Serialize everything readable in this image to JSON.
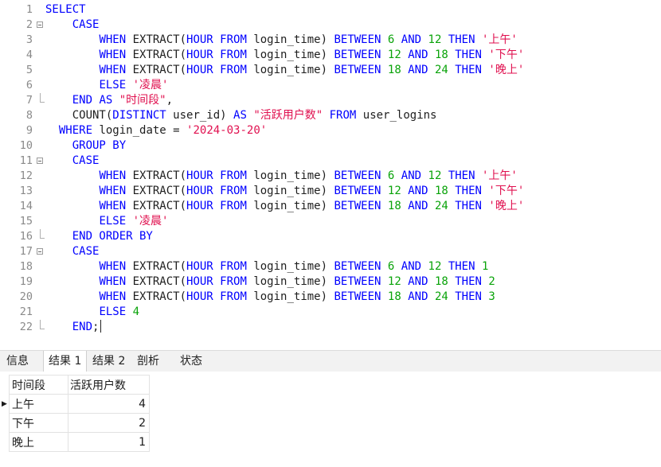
{
  "editor": {
    "lines": [
      {
        "n": "1",
        "fold": "",
        "tokens": [
          {
            "t": "SELECT",
            "c": "kw"
          }
        ]
      },
      {
        "n": "2",
        "fold": "open",
        "tokens": [
          {
            "t": "    "
          },
          {
            "t": "CASE",
            "c": "kw"
          }
        ]
      },
      {
        "n": "3",
        "fold": "",
        "tokens": [
          {
            "t": "        "
          },
          {
            "t": "WHEN",
            "c": "kw"
          },
          {
            "t": " EXTRACT("
          },
          {
            "t": "HOUR",
            "c": "kw"
          },
          {
            "t": " "
          },
          {
            "t": "FROM",
            "c": "kw"
          },
          {
            "t": " login_time) "
          },
          {
            "t": "BETWEEN",
            "c": "kw"
          },
          {
            "t": " "
          },
          {
            "t": "6",
            "c": "num"
          },
          {
            "t": " "
          },
          {
            "t": "AND",
            "c": "kw"
          },
          {
            "t": " "
          },
          {
            "t": "12",
            "c": "num"
          },
          {
            "t": " "
          },
          {
            "t": "THEN",
            "c": "kw"
          },
          {
            "t": " "
          },
          {
            "t": "'上午'",
            "c": "str"
          }
        ]
      },
      {
        "n": "4",
        "fold": "",
        "tokens": [
          {
            "t": "        "
          },
          {
            "t": "WHEN",
            "c": "kw"
          },
          {
            "t": " EXTRACT("
          },
          {
            "t": "HOUR",
            "c": "kw"
          },
          {
            "t": " "
          },
          {
            "t": "FROM",
            "c": "kw"
          },
          {
            "t": " login_time) "
          },
          {
            "t": "BETWEEN",
            "c": "kw"
          },
          {
            "t": " "
          },
          {
            "t": "12",
            "c": "num"
          },
          {
            "t": " "
          },
          {
            "t": "AND",
            "c": "kw"
          },
          {
            "t": " "
          },
          {
            "t": "18",
            "c": "num"
          },
          {
            "t": " "
          },
          {
            "t": "THEN",
            "c": "kw"
          },
          {
            "t": " "
          },
          {
            "t": "'下午'",
            "c": "str"
          }
        ]
      },
      {
        "n": "5",
        "fold": "",
        "tokens": [
          {
            "t": "        "
          },
          {
            "t": "WHEN",
            "c": "kw"
          },
          {
            "t": " EXTRACT("
          },
          {
            "t": "HOUR",
            "c": "kw"
          },
          {
            "t": " "
          },
          {
            "t": "FROM",
            "c": "kw"
          },
          {
            "t": " login_time) "
          },
          {
            "t": "BETWEEN",
            "c": "kw"
          },
          {
            "t": " "
          },
          {
            "t": "18",
            "c": "num"
          },
          {
            "t": " "
          },
          {
            "t": "AND",
            "c": "kw"
          },
          {
            "t": " "
          },
          {
            "t": "24",
            "c": "num"
          },
          {
            "t": " "
          },
          {
            "t": "THEN",
            "c": "kw"
          },
          {
            "t": " "
          },
          {
            "t": "'晚上'",
            "c": "str"
          }
        ]
      },
      {
        "n": "6",
        "fold": "",
        "tokens": [
          {
            "t": "        "
          },
          {
            "t": "ELSE",
            "c": "kw"
          },
          {
            "t": " "
          },
          {
            "t": "'凌晨'",
            "c": "str"
          }
        ]
      },
      {
        "n": "7",
        "fold": "end",
        "tokens": [
          {
            "t": "    "
          },
          {
            "t": "END",
            "c": "kw"
          },
          {
            "t": " "
          },
          {
            "t": "AS",
            "c": "kw"
          },
          {
            "t": " "
          },
          {
            "t": "\"时间段\"",
            "c": "str"
          },
          {
            "t": ","
          }
        ]
      },
      {
        "n": "8",
        "fold": "",
        "tokens": [
          {
            "t": "    COUNT("
          },
          {
            "t": "DISTINCT",
            "c": "kw"
          },
          {
            "t": " user_id) "
          },
          {
            "t": "AS",
            "c": "kw"
          },
          {
            "t": " "
          },
          {
            "t": "\"活跃用户数\"",
            "c": "str"
          },
          {
            "t": " "
          },
          {
            "t": "FROM",
            "c": "kw"
          },
          {
            "t": " user_logins"
          }
        ]
      },
      {
        "n": "9",
        "fold": "",
        "tokens": [
          {
            "t": "  "
          },
          {
            "t": "WHERE",
            "c": "kw"
          },
          {
            "t": " login_date = "
          },
          {
            "t": "'2024-03-20'",
            "c": "str"
          }
        ]
      },
      {
        "n": "10",
        "fold": "",
        "tokens": [
          {
            "t": "    "
          },
          {
            "t": "GROUP BY",
            "c": "kw"
          }
        ]
      },
      {
        "n": "11",
        "fold": "open",
        "tokens": [
          {
            "t": "    "
          },
          {
            "t": "CASE",
            "c": "kw"
          }
        ]
      },
      {
        "n": "12",
        "fold": "",
        "tokens": [
          {
            "t": "        "
          },
          {
            "t": "WHEN",
            "c": "kw"
          },
          {
            "t": " EXTRACT("
          },
          {
            "t": "HOUR",
            "c": "kw"
          },
          {
            "t": " "
          },
          {
            "t": "FROM",
            "c": "kw"
          },
          {
            "t": " login_time) "
          },
          {
            "t": "BETWEEN",
            "c": "kw"
          },
          {
            "t": " "
          },
          {
            "t": "6",
            "c": "num"
          },
          {
            "t": " "
          },
          {
            "t": "AND",
            "c": "kw"
          },
          {
            "t": " "
          },
          {
            "t": "12",
            "c": "num"
          },
          {
            "t": " "
          },
          {
            "t": "THEN",
            "c": "kw"
          },
          {
            "t": " "
          },
          {
            "t": "'上午'",
            "c": "str"
          }
        ]
      },
      {
        "n": "13",
        "fold": "",
        "tokens": [
          {
            "t": "        "
          },
          {
            "t": "WHEN",
            "c": "kw"
          },
          {
            "t": " EXTRACT("
          },
          {
            "t": "HOUR",
            "c": "kw"
          },
          {
            "t": " "
          },
          {
            "t": "FROM",
            "c": "kw"
          },
          {
            "t": " login_time) "
          },
          {
            "t": "BETWEEN",
            "c": "kw"
          },
          {
            "t": " "
          },
          {
            "t": "12",
            "c": "num"
          },
          {
            "t": " "
          },
          {
            "t": "AND",
            "c": "kw"
          },
          {
            "t": " "
          },
          {
            "t": "18",
            "c": "num"
          },
          {
            "t": " "
          },
          {
            "t": "THEN",
            "c": "kw"
          },
          {
            "t": " "
          },
          {
            "t": "'下午'",
            "c": "str"
          }
        ]
      },
      {
        "n": "14",
        "fold": "",
        "tokens": [
          {
            "t": "        "
          },
          {
            "t": "WHEN",
            "c": "kw"
          },
          {
            "t": " EXTRACT("
          },
          {
            "t": "HOUR",
            "c": "kw"
          },
          {
            "t": " "
          },
          {
            "t": "FROM",
            "c": "kw"
          },
          {
            "t": " login_time) "
          },
          {
            "t": "BETWEEN",
            "c": "kw"
          },
          {
            "t": " "
          },
          {
            "t": "18",
            "c": "num"
          },
          {
            "t": " "
          },
          {
            "t": "AND",
            "c": "kw"
          },
          {
            "t": " "
          },
          {
            "t": "24",
            "c": "num"
          },
          {
            "t": " "
          },
          {
            "t": "THEN",
            "c": "kw"
          },
          {
            "t": " "
          },
          {
            "t": "'晚上'",
            "c": "str"
          }
        ]
      },
      {
        "n": "15",
        "fold": "",
        "tokens": [
          {
            "t": "        "
          },
          {
            "t": "ELSE",
            "c": "kw"
          },
          {
            "t": " "
          },
          {
            "t": "'凌晨'",
            "c": "str"
          }
        ]
      },
      {
        "n": "16",
        "fold": "end",
        "tokens": [
          {
            "t": "    "
          },
          {
            "t": "END ORDER BY",
            "c": "kw"
          }
        ]
      },
      {
        "n": "17",
        "fold": "open",
        "tokens": [
          {
            "t": "    "
          },
          {
            "t": "CASE",
            "c": "kw"
          }
        ]
      },
      {
        "n": "18",
        "fold": "",
        "tokens": [
          {
            "t": "        "
          },
          {
            "t": "WHEN",
            "c": "kw"
          },
          {
            "t": " EXTRACT("
          },
          {
            "t": "HOUR",
            "c": "kw"
          },
          {
            "t": " "
          },
          {
            "t": "FROM",
            "c": "kw"
          },
          {
            "t": " login_time) "
          },
          {
            "t": "BETWEEN",
            "c": "kw"
          },
          {
            "t": " "
          },
          {
            "t": "6",
            "c": "num"
          },
          {
            "t": " "
          },
          {
            "t": "AND",
            "c": "kw"
          },
          {
            "t": " "
          },
          {
            "t": "12",
            "c": "num"
          },
          {
            "t": " "
          },
          {
            "t": "THEN",
            "c": "kw"
          },
          {
            "t": " "
          },
          {
            "t": "1",
            "c": "num"
          }
        ]
      },
      {
        "n": "19",
        "fold": "",
        "tokens": [
          {
            "t": "        "
          },
          {
            "t": "WHEN",
            "c": "kw"
          },
          {
            "t": " EXTRACT("
          },
          {
            "t": "HOUR",
            "c": "kw"
          },
          {
            "t": " "
          },
          {
            "t": "FROM",
            "c": "kw"
          },
          {
            "t": " login_time) "
          },
          {
            "t": "BETWEEN",
            "c": "kw"
          },
          {
            "t": " "
          },
          {
            "t": "12",
            "c": "num"
          },
          {
            "t": " "
          },
          {
            "t": "AND",
            "c": "kw"
          },
          {
            "t": " "
          },
          {
            "t": "18",
            "c": "num"
          },
          {
            "t": " "
          },
          {
            "t": "THEN",
            "c": "kw"
          },
          {
            "t": " "
          },
          {
            "t": "2",
            "c": "num"
          }
        ]
      },
      {
        "n": "20",
        "fold": "",
        "tokens": [
          {
            "t": "        "
          },
          {
            "t": "WHEN",
            "c": "kw"
          },
          {
            "t": " EXTRACT("
          },
          {
            "t": "HOUR",
            "c": "kw"
          },
          {
            "t": " "
          },
          {
            "t": "FROM",
            "c": "kw"
          },
          {
            "t": " login_time) "
          },
          {
            "t": "BETWEEN",
            "c": "kw"
          },
          {
            "t": " "
          },
          {
            "t": "18",
            "c": "num"
          },
          {
            "t": " "
          },
          {
            "t": "AND",
            "c": "kw"
          },
          {
            "t": " "
          },
          {
            "t": "24",
            "c": "num"
          },
          {
            "t": " "
          },
          {
            "t": "THEN",
            "c": "kw"
          },
          {
            "t": " "
          },
          {
            "t": "3",
            "c": "num"
          }
        ]
      },
      {
        "n": "21",
        "fold": "",
        "tokens": [
          {
            "t": "        "
          },
          {
            "t": "ELSE",
            "c": "kw"
          },
          {
            "t": " "
          },
          {
            "t": "4",
            "c": "num"
          }
        ]
      },
      {
        "n": "22",
        "fold": "end",
        "tokens": [
          {
            "t": "    "
          },
          {
            "t": "END",
            "c": "kw"
          },
          {
            "t": ";"
          }
        ],
        "caret": true
      }
    ]
  },
  "result_tabs": {
    "info": "信息",
    "result1": "结果 1",
    "result2": "结果 2",
    "profile": "剖析",
    "status": "状态"
  },
  "result_grid": {
    "columns": [
      "时间段",
      "活跃用户数"
    ],
    "rows": [
      {
        "period": "上午",
        "count": "4",
        "current": true
      },
      {
        "period": "下午",
        "count": "2",
        "current": false
      },
      {
        "period": "晚上",
        "count": "1",
        "current": false
      }
    ]
  },
  "colors": {
    "keyword": "#0000ff",
    "number": "#09a309",
    "string": "#e0104f",
    "line_number": "#8a8a8a"
  }
}
